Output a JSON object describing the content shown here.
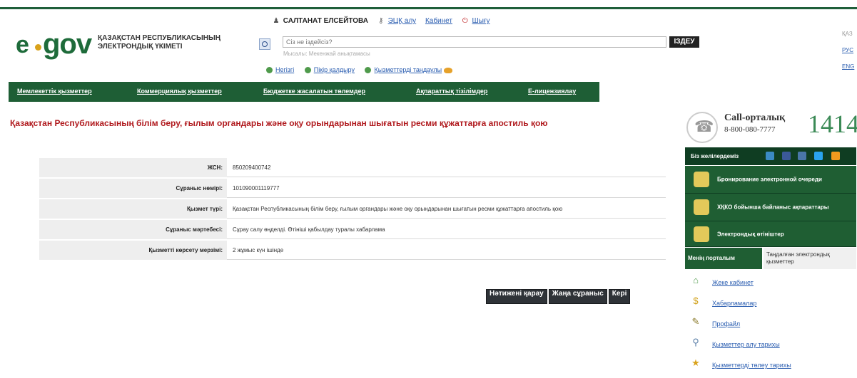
{
  "header": {
    "logo_e": "e",
    "logo_gov": "gov",
    "logo_text": "ҚАЗАҚСТАН РЕСПУБЛИКАСЫНЫҢ ЭЛЕКТРОНДЫҚ ҮКІМЕТІ",
    "user_name": "САЛТАНАТ ЕЛСЕЙТОВА",
    "links": [
      "ЭЦҚ алу",
      "Кабинет",
      "Шығу"
    ],
    "search_placeholder": "Сіз не іздейсіз?",
    "search_hint": "Мысалы: Мекенжай анықтамасы",
    "search_button": "ІЗДЕУ",
    "quick_links": [
      "Негізгі",
      "Пікір қалдыру",
      "Қызметтерді таңдаулы"
    ],
    "languages": {
      "kaz": "ҚАЗ",
      "rus": "РУС",
      "eng": "ENG"
    }
  },
  "nav": {
    "items": [
      "Мемлекеттік қызметтер",
      "Коммерциялық қызметтер",
      "Бюджетке жасалатын төлемдер",
      "Ақпараттық тізілімдер",
      "Е-лицензиялау"
    ]
  },
  "page": {
    "title": "Қазақстан Республикасының білім беру, ғылым органдары және оқу орындарынан шығатын ресми құжаттарға апостиль қою"
  },
  "details": {
    "rows": [
      {
        "label": "ЖСН:",
        "value": "850209400742"
      },
      {
        "label": "Сұраныс нөмірі:",
        "value": "101090001119777"
      },
      {
        "label": "Қызмет түрі:",
        "value": "Қазақстан Республикасының білім беру, ғылым органдары және оқу орындарынан шығатын ресми құжаттарға апостиль қою"
      },
      {
        "label": "Сұраныс мәртебесі:",
        "value": "Сұрау салу өңделді. Өтініші қабылдау туралы хабарлама"
      },
      {
        "label": "Қызметті көрсету мерзімі:",
        "value": "2 жұмыс күн ішінде"
      }
    ]
  },
  "buttons": {
    "view_result": "Нәтижені қарау",
    "new_request": "Жаңа сұраныс",
    "back": "Кері"
  },
  "sidebar": {
    "call_title": "Call-орталық",
    "call_phone": "8-800-080-7777",
    "call_short": "1414",
    "social_label": "Біз желілердеміз",
    "social_colors": [
      "#3b8ac4",
      "#3b5998",
      "#4a76a8",
      "#2aa3ef",
      "#f29a1e"
    ],
    "green_items": [
      "Бронирование электронной очереди",
      "ХҚКО бойынша байланыс ақпараттары",
      "Электрондық өтініштер"
    ],
    "tab_active": "Менің порталым",
    "tab_other": "Таңдалған электрондық қызметтер",
    "menu": [
      {
        "icon": "home-icon",
        "label": "Жеке кабинет"
      },
      {
        "icon": "messages-icon",
        "label": "Хабарламалар"
      },
      {
        "icon": "profile-icon",
        "label": "Профайл"
      },
      {
        "icon": "history-icon",
        "label": "Қызметтер алу тарихы"
      },
      {
        "icon": "payments-icon",
        "label": "Қызметтерді төлеу тарихы"
      }
    ]
  }
}
